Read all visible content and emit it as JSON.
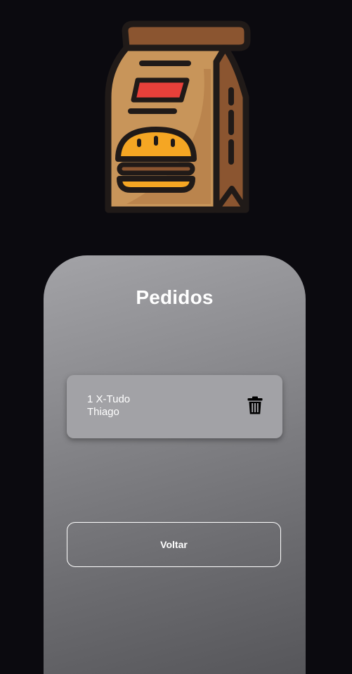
{
  "logo": {
    "icon": "burger-takeout-bag-icon"
  },
  "panel": {
    "title": "Pedidos",
    "orders": [
      {
        "item": "1 X-Tudo",
        "customer": "Thiago",
        "action_icon": "trash-icon"
      }
    ],
    "back_label": "Voltar"
  },
  "colors": {
    "background": "#0b0a0f",
    "bag_brown": "#c8955a",
    "bag_dark": "#8b5530",
    "label_red": "#e8403a",
    "burger_orange": "#f5a623"
  }
}
